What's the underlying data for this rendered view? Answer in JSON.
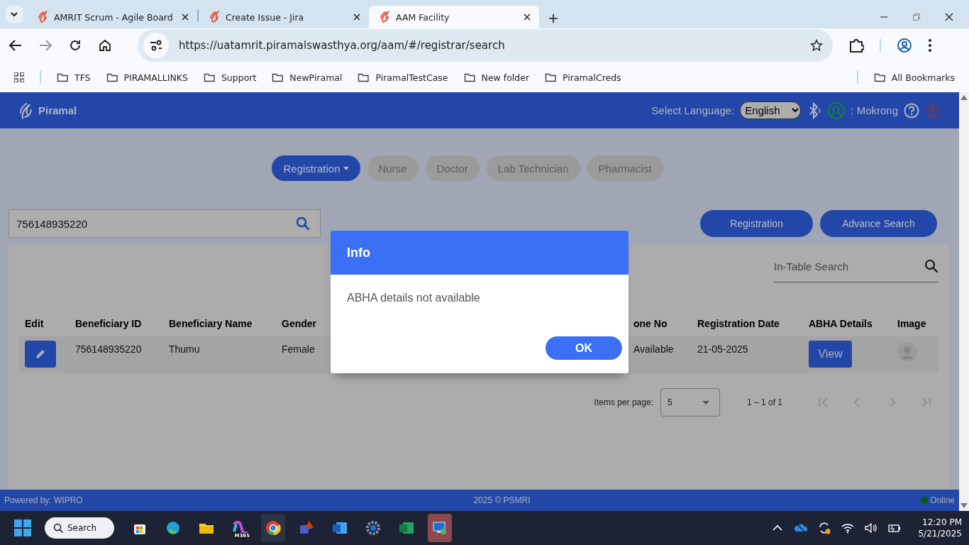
{
  "browser": {
    "tabs": [
      {
        "title": "AMRIT Scrum - Agile Board",
        "selected": false
      },
      {
        "title": "Create Issue - Jira",
        "selected": false
      },
      {
        "title": "AAM Facility",
        "selected": true
      }
    ],
    "url": "https://uatamrit.piramalswasthya.org/aam/#/registrar/search",
    "bookmarks": [
      "TFS",
      "PIRAMALLINKS",
      "Support",
      "NewPiramal",
      "PiramalTestCase",
      "New folder",
      "PiramalCreds"
    ],
    "all_bookmarks": "All Bookmarks"
  },
  "app": {
    "logo": "Piramal",
    "language_label": "Select Language:",
    "language": "English",
    "user": ": Mokrong",
    "role_tabs": [
      {
        "label": "Registration",
        "selected": true
      },
      {
        "label": "Nurse",
        "selected": false
      },
      {
        "label": "Doctor",
        "selected": false
      },
      {
        "label": "Lab Technician",
        "selected": false
      },
      {
        "label": "Pharmacist",
        "selected": false
      }
    ],
    "search": {
      "value": "756148935220"
    },
    "buttons": [
      "Registration",
      "Advance Search"
    ],
    "table_search": {
      "placeholder": "In-Table Search"
    },
    "table": {
      "columns": [
        "Edit",
        "Beneficiary ID",
        "Beneficiary Name",
        "Gender",
        "one No",
        "Registration Date",
        "ABHA Details",
        "Image"
      ],
      "rows": [
        {
          "beneficiary_id": "756148935220",
          "name": "Thumu",
          "gender": "Female",
          "phone": "Available",
          "registration_date": "21-05-2025",
          "abha": "View"
        }
      ]
    },
    "paginator": {
      "label": "Items per page:",
      "page_size": "5",
      "range": "1 – 1 of 1"
    },
    "footer": {
      "powered": "Powered by: WIPRO",
      "copyright": "2025 © PSMRI",
      "status": "Online"
    }
  },
  "dialog": {
    "title": "Info",
    "message": "ABHA details not available",
    "button": "OK"
  },
  "taskbar": {
    "search": "Search",
    "copilot_label": "M365",
    "time": "12:20 PM",
    "date": "5/21/2025"
  }
}
